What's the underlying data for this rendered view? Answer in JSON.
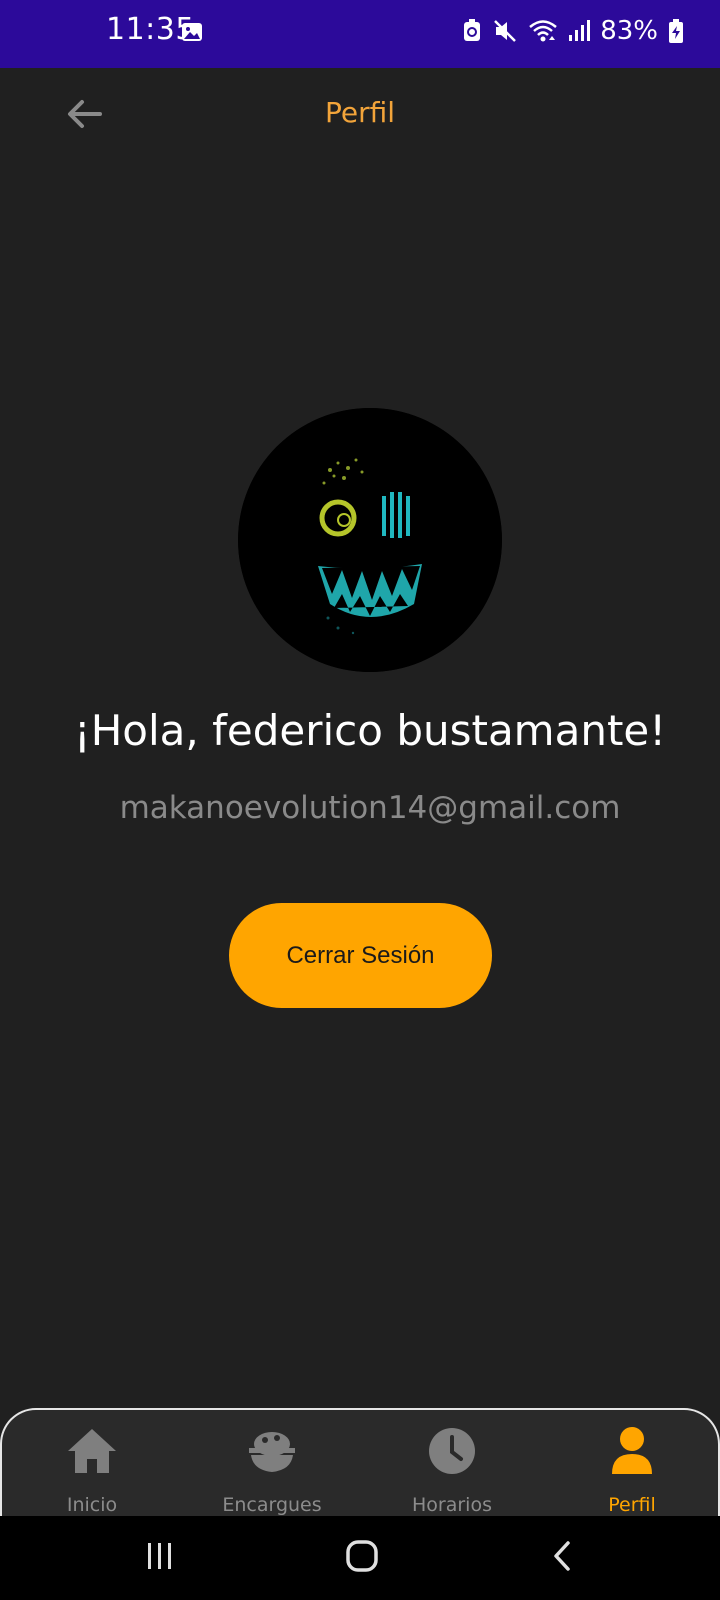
{
  "status_bar": {
    "time": "11:35",
    "battery_percent": "83%",
    "icons": [
      "gallery-icon",
      "battery-saver-icon",
      "mute-icon",
      "wifi-icon",
      "signal-icon",
      "battery-charging-icon"
    ]
  },
  "app_bar": {
    "title": "Perfil",
    "back_icon": "arrow-left-icon"
  },
  "profile": {
    "greeting": "¡Hola, federico bustamante!",
    "email": "makanoevolution14@gmail.com",
    "avatar_icon": "monster-face-avatar"
  },
  "actions": {
    "logout_label": "Cerrar Sesión"
  },
  "bottom_nav": {
    "items": [
      {
        "label": "Inicio",
        "icon": "home-icon",
        "active": false
      },
      {
        "label": "Encargues",
        "icon": "rice-bowl-icon",
        "active": false
      },
      {
        "label": "Horarios",
        "icon": "clock-icon",
        "active": false
      },
      {
        "label": "Perfil",
        "icon": "person-icon",
        "active": true
      }
    ]
  },
  "system_nav": {
    "buttons": [
      "recents-icon",
      "home-icon",
      "back-icon"
    ]
  },
  "colors": {
    "background": "#202020",
    "status_bar": "#2c0a9a",
    "accent": "#ffa500",
    "title": "#f2a43a",
    "inactive": "#8c8c8c"
  }
}
